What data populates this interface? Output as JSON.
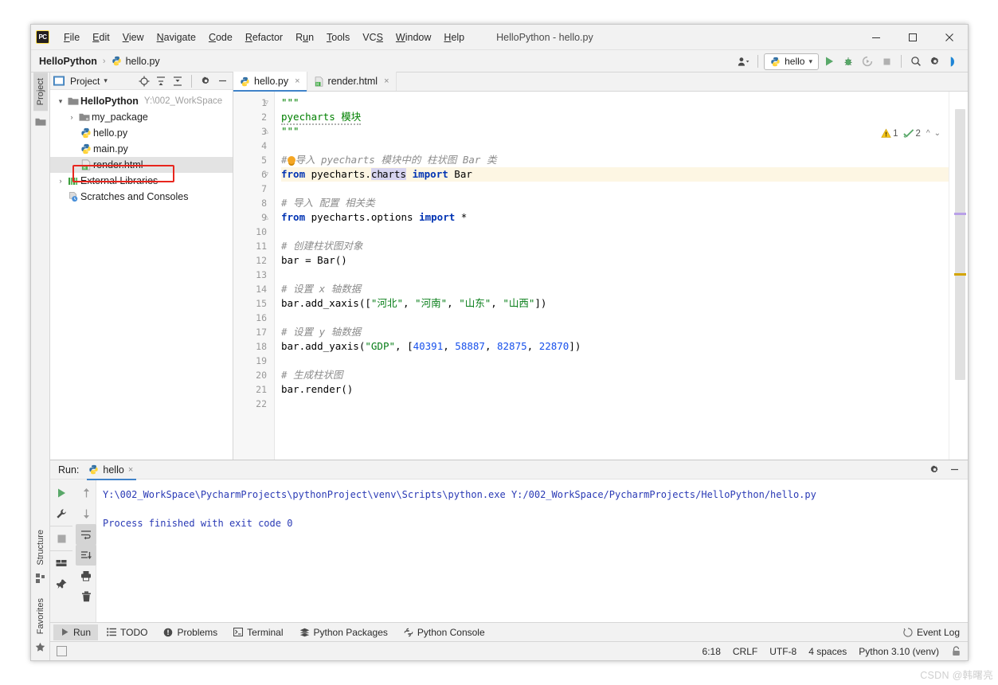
{
  "window": {
    "title": "HelloPython - hello.py",
    "app_icon": "pycharm-logo-icon",
    "controls": {
      "minimize": "minimize-icon",
      "maximize": "maximize-icon",
      "close": "close-icon"
    }
  },
  "menubar": {
    "items": [
      {
        "label": "File",
        "mnemonic": "F"
      },
      {
        "label": "Edit",
        "mnemonic": "E"
      },
      {
        "label": "View",
        "mnemonic": "V"
      },
      {
        "label": "Navigate",
        "mnemonic": "N"
      },
      {
        "label": "Code",
        "mnemonic": "C"
      },
      {
        "label": "Refactor",
        "mnemonic": "R"
      },
      {
        "label": "Run",
        "mnemonic": "u"
      },
      {
        "label": "Tools",
        "mnemonic": "T"
      },
      {
        "label": "VCS",
        "mnemonic": "S"
      },
      {
        "label": "Window",
        "mnemonic": "W"
      },
      {
        "label": "Help",
        "mnemonic": "H"
      }
    ]
  },
  "navbar": {
    "breadcrumbs": [
      {
        "label": "HelloPython",
        "icon": ""
      },
      {
        "label": "hello.py",
        "icon": "python-file-icon"
      }
    ],
    "separator": "›",
    "run_config": {
      "label": "hello",
      "icon": "python-file-icon",
      "chevron": "▾"
    },
    "actions": [
      {
        "name": "user-settings-icon",
        "glyph": "☰"
      },
      {
        "name": "run-icon",
        "glyph": "▶"
      },
      {
        "name": "debug-icon",
        "glyph": "🐞"
      },
      {
        "name": "run-coverage-icon",
        "glyph": "⭮"
      },
      {
        "name": "stop-icon",
        "glyph": "■"
      },
      {
        "name": "search-everywhere-icon",
        "glyph": "🔍"
      },
      {
        "name": "settings-gear-icon",
        "glyph": "⚙"
      },
      {
        "name": "datalore-icon",
        "glyph": "◖"
      }
    ]
  },
  "left_strip": {
    "top_tab": "Project",
    "bottom_tabs": [
      "Structure",
      "Favorites"
    ]
  },
  "project_panel": {
    "title": "Project",
    "header_icons": [
      "scope-target-icon",
      "expand-all-icon",
      "collapse-all-icon",
      "settings-gear-icon",
      "hide-icon"
    ],
    "tree": [
      {
        "label": "HelloPython",
        "path": "Y:\\002_WorkSpace",
        "icon": "folder-icon",
        "arrow": "⌄",
        "indent": 0,
        "bold": true,
        "selected": false
      },
      {
        "label": "my_package",
        "path": "",
        "icon": "package-folder-icon",
        "arrow": "›",
        "indent": 1,
        "bold": false,
        "selected": false
      },
      {
        "label": "hello.py",
        "path": "",
        "icon": "python-file-icon",
        "arrow": "",
        "indent": 2,
        "bold": false,
        "selected": false
      },
      {
        "label": "main.py",
        "path": "",
        "icon": "python-file-icon",
        "arrow": "",
        "indent": 2,
        "bold": false,
        "selected": false
      },
      {
        "label": "render.html",
        "path": "",
        "icon": "html-file-icon",
        "arrow": "",
        "indent": 2,
        "bold": false,
        "selected": true
      },
      {
        "label": "External Libraries",
        "path": "",
        "icon": "library-icon",
        "arrow": "›",
        "indent": 0,
        "bold": false,
        "selected": false
      },
      {
        "label": "Scratches and Consoles",
        "path": "",
        "icon": "scratches-icon",
        "arrow": "",
        "indent": 1,
        "bold": false,
        "selected": false
      }
    ],
    "highlight_annotation": "red-box-around-render-html"
  },
  "editor": {
    "tabs": [
      {
        "label": "hello.py",
        "icon": "python-file-icon",
        "active": true,
        "close": "×"
      },
      {
        "label": "render.html",
        "icon": "html-file-icon",
        "active": false,
        "close": "×"
      }
    ],
    "inspection": {
      "warning_count": "1",
      "check_count": "2",
      "up": "⌃",
      "down": "⌄"
    },
    "line_numbers": [
      "1",
      "2",
      "3",
      "4",
      "5",
      "6",
      "7",
      "8",
      "9",
      "10",
      "11",
      "12",
      "13",
      "14",
      "15",
      "16",
      "17",
      "18",
      "19",
      "20",
      "21",
      "22"
    ],
    "lines": [
      {
        "n": 1,
        "text": "\"\"\""
      },
      {
        "n": 2,
        "text": "pyecharts 模块"
      },
      {
        "n": 3,
        "text": "\"\"\""
      },
      {
        "n": 4,
        "text": ""
      },
      {
        "n": 5,
        "text": "# 导入 pyecharts 模块中的 柱状图 Bar 类"
      },
      {
        "n": 6,
        "text": "from pyecharts.charts import Bar"
      },
      {
        "n": 7,
        "text": ""
      },
      {
        "n": 8,
        "text": "# 导入 配置 相关类"
      },
      {
        "n": 9,
        "text": "from pyecharts.options import *"
      },
      {
        "n": 10,
        "text": ""
      },
      {
        "n": 11,
        "text": "# 创建柱状图对象"
      },
      {
        "n": 12,
        "text": "bar = Bar()"
      },
      {
        "n": 13,
        "text": ""
      },
      {
        "n": 14,
        "text": "# 设置 x 轴数据"
      },
      {
        "n": 15,
        "text": "bar.add_xaxis([\"河北\", \"河南\", \"山东\", \"山西\"])"
      },
      {
        "n": 16,
        "text": ""
      },
      {
        "n": 17,
        "text": "# 设置 y 轴数据"
      },
      {
        "n": 18,
        "text": "bar.add_yaxis(\"GDP\", [40391, 58887, 82875, 22870])"
      },
      {
        "n": 19,
        "text": ""
      },
      {
        "n": 20,
        "text": "# 生成柱状图"
      },
      {
        "n": 21,
        "text": "bar.render()"
      },
      {
        "n": 22,
        "text": ""
      }
    ],
    "tokens": {
      "kw_from": "from",
      "kw_import": "import",
      "mod_charts": "pyecharts.charts",
      "mod_options": "pyecharts.options",
      "cls_bar": "Bar",
      "star": "*",
      "var_bar": "bar",
      "assign": "=",
      "call_bar": "Bar()",
      "m_add_xaxis": "bar.add_xaxis",
      "m_add_yaxis": "bar.add_yaxis",
      "m_render": "bar.render()",
      "xaxis_values": [
        "河北",
        "河南",
        "山东",
        "山西"
      ],
      "yaxis_name": "GDP",
      "yaxis_values": [
        "40391",
        "58887",
        "82875",
        "22870"
      ],
      "docstring": "\"\"\"",
      "doc_body": "pyecharts 模块",
      "cmt5": "导入 pyecharts 模块中的 柱状图 Bar 类",
      "cmt8": "# 导入 配置 相关类",
      "cmt11": "# 创建柱状图对象",
      "cmt14": "# 设置 x 轴数据",
      "cmt17": "# 设置 y 轴数据",
      "cmt20": "# 生成柱状图",
      "sel_text": "ch",
      "sel_text2": "arts"
    }
  },
  "run_panel": {
    "label": "Run:",
    "tab": {
      "label": "hello",
      "icon": "python-file-icon",
      "close": "×"
    },
    "header_icons": [
      "settings-gear-icon",
      "hide-icon"
    ],
    "tools": [
      {
        "name": "rerun-icon",
        "glyph": "▶"
      },
      {
        "name": "wrench-icon",
        "glyph": "🔧"
      },
      {
        "name": "stop-icon",
        "glyph": "■"
      },
      {
        "name": "layout-icon",
        "glyph": "▤"
      },
      {
        "name": "pin-icon",
        "glyph": "📌"
      },
      {
        "name": "up-arrow-icon",
        "glyph": "↑"
      },
      {
        "name": "down-arrow-icon",
        "glyph": "↓"
      },
      {
        "name": "soft-wrap-icon",
        "glyph": "↵"
      },
      {
        "name": "scroll-to-end-icon",
        "glyph": "↓"
      },
      {
        "name": "print-icon",
        "glyph": "🖨"
      },
      {
        "name": "trash-icon",
        "glyph": "🗑"
      }
    ],
    "output": [
      "Y:\\002_WorkSpace\\PycharmProjects\\pythonProject\\venv\\Scripts\\python.exe Y:/002_WorkSpace/PycharmProjects/HelloPython/hello.py",
      "",
      "Process finished with exit code 0"
    ]
  },
  "bottom_tabs": {
    "items": [
      {
        "label": "Run",
        "icon": "run-play-icon",
        "active": true
      },
      {
        "label": "TODO",
        "icon": "todo-list-icon",
        "active": false
      },
      {
        "label": "Problems",
        "icon": "problems-icon",
        "active": false
      },
      {
        "label": "Terminal",
        "icon": "terminal-icon",
        "active": false
      },
      {
        "label": "Python Packages",
        "icon": "packages-icon",
        "active": false
      },
      {
        "label": "Python Console",
        "icon": "python-console-icon",
        "active": false
      }
    ],
    "event_log": {
      "label": "Event Log",
      "icon": "event-log-icon"
    }
  },
  "statusbar": {
    "caret_position": "6:18",
    "line_separator": "CRLF",
    "encoding": "UTF-8",
    "indent": "4 spaces",
    "interpreter": "Python 3.10 (venv)",
    "lock_icon": "lock-icon"
  },
  "watermark": "CSDN @韩曙亮",
  "colors": {
    "accent_blue": "#4083c9",
    "keyword_blue": "#0033b3",
    "string_green": "#067d17",
    "number_blue": "#1750eb",
    "comment_gray": "#8c8c8c",
    "console_blue": "#2a3ab5",
    "highlight_red": "#e8261e",
    "current_line": "#fdf6e3",
    "selection": "#d7d4f0"
  }
}
